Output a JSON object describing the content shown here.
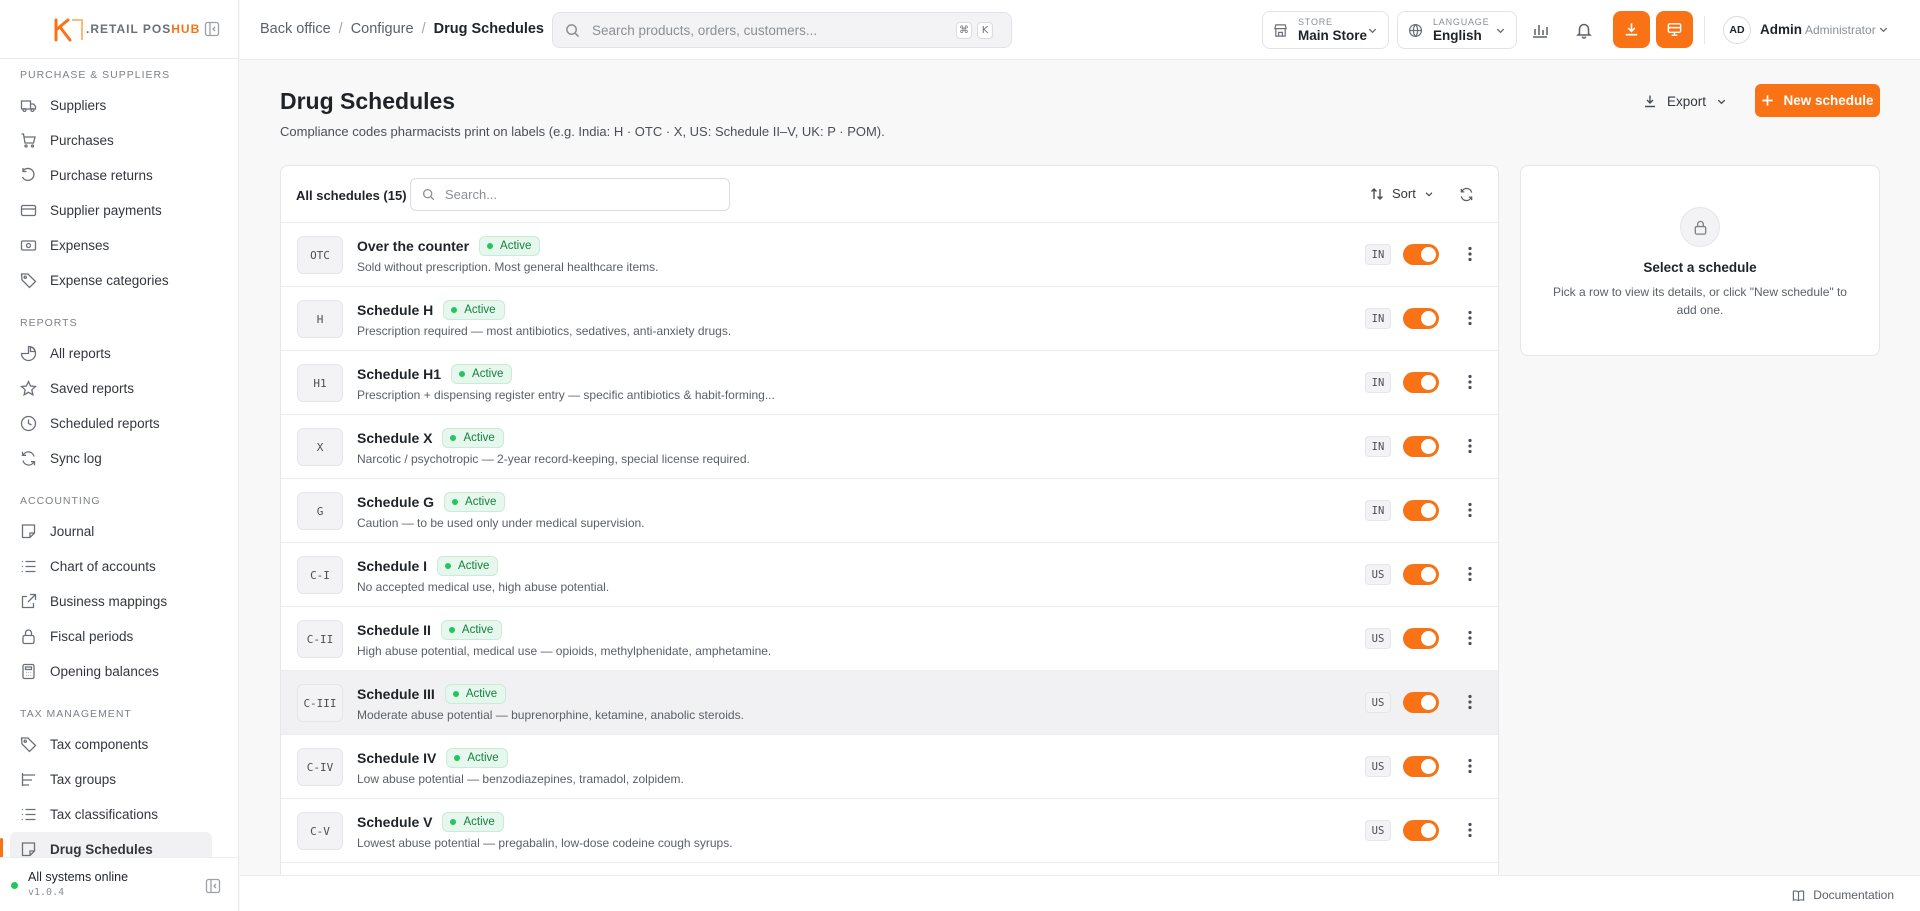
{
  "brand": {
    "name_prefix": ".RETAIL POS",
    "name_suffix": "HUB",
    "accent": "#f97316"
  },
  "sidebar": {
    "sections": [
      {
        "title": "Purchase & Suppliers",
        "items": [
          {
            "label": "Suppliers",
            "icon": "truck-icon"
          },
          {
            "label": "Purchases",
            "icon": "cart-icon"
          },
          {
            "label": "Purchase returns",
            "icon": "return-icon"
          },
          {
            "label": "Supplier payments",
            "icon": "card-icon"
          },
          {
            "label": "Expenses",
            "icon": "cash-icon"
          },
          {
            "label": "Expense categories",
            "icon": "tag-icon"
          }
        ]
      },
      {
        "title": "Reports",
        "items": [
          {
            "label": "All reports",
            "icon": "pie-icon"
          },
          {
            "label": "Saved reports",
            "icon": "star-icon"
          },
          {
            "label": "Scheduled reports",
            "icon": "clock-icon"
          },
          {
            "label": "Sync log",
            "icon": "sync-icon"
          }
        ]
      },
      {
        "title": "Accounting",
        "items": [
          {
            "label": "Journal",
            "icon": "note-icon"
          },
          {
            "label": "Chart of accounts",
            "icon": "list-icon"
          },
          {
            "label": "Business mappings",
            "icon": "external-icon"
          },
          {
            "label": "Fiscal periods",
            "icon": "lock-icon"
          },
          {
            "label": "Opening balances",
            "icon": "calculator-icon"
          }
        ]
      },
      {
        "title": "Tax Management",
        "items": [
          {
            "label": "Tax components",
            "icon": "tag-icon"
          },
          {
            "label": "Tax groups",
            "icon": "tree-icon"
          },
          {
            "label": "Tax classifications",
            "icon": "list-icon"
          },
          {
            "label": "Drug Schedules",
            "icon": "note-icon",
            "active": true
          }
        ]
      }
    ],
    "footer": {
      "status": "All systems online",
      "version": "v1.0.4"
    }
  },
  "topbar": {
    "breadcrumb": [
      "Back office",
      "Configure",
      "Drug Schedules"
    ],
    "search_placeholder": "Search products, orders, customers...",
    "shortcut": [
      "⌘",
      "K"
    ],
    "store": {
      "label": "Store",
      "value": "Main Store"
    },
    "language": {
      "label": "Language",
      "value": "English"
    },
    "user": {
      "initials": "AD",
      "name": "Admin",
      "role": "Administrator"
    }
  },
  "page": {
    "title": "Drug Schedules",
    "subtitle": "Compliance codes pharmacists print on labels (e.g. India: H · OTC · X, US: Schedule II–V, UK: P · POM).",
    "export_label": "Export",
    "new_label": "New schedule"
  },
  "list": {
    "count_label": "All schedules (15)",
    "search_placeholder": "Search...",
    "sort_label": "Sort",
    "rows": [
      {
        "code": "OTC",
        "name": "Over the counter",
        "status": "Active",
        "desc": "Sold without prescription. Most general healthcare items.",
        "region": "IN",
        "enabled": true
      },
      {
        "code": "H",
        "name": "Schedule H",
        "status": "Active",
        "desc": "Prescription required — most antibiotics, sedatives, anti-anxiety drugs.",
        "region": "IN",
        "enabled": true
      },
      {
        "code": "H1",
        "name": "Schedule H1",
        "status": "Active",
        "desc": "Prescription + dispensing register entry — specific antibiotics & habit-forming...",
        "region": "IN",
        "enabled": true
      },
      {
        "code": "X",
        "name": "Schedule X",
        "status": "Active",
        "desc": "Narcotic / psychotropic — 2-year record-keeping, special license required.",
        "region": "IN",
        "enabled": true
      },
      {
        "code": "G",
        "name": "Schedule G",
        "status": "Active",
        "desc": "Caution — to be used only under medical supervision.",
        "region": "IN",
        "enabled": true
      },
      {
        "code": "C-I",
        "name": "Schedule I",
        "status": "Active",
        "desc": "No accepted medical use, high abuse potential.",
        "region": "US",
        "enabled": true
      },
      {
        "code": "C-II",
        "name": "Schedule II",
        "status": "Active",
        "desc": "High abuse potential, medical use — opioids, methylphenidate, amphetamine.",
        "region": "US",
        "enabled": true
      },
      {
        "code": "C-III",
        "name": "Schedule III",
        "status": "Active",
        "desc": "Moderate abuse potential — buprenorphine, ketamine, anabolic steroids.",
        "region": "US",
        "enabled": true,
        "highlight": true
      },
      {
        "code": "C-IV",
        "name": "Schedule IV",
        "status": "Active",
        "desc": "Low abuse potential — benzodiazepines, tramadol, zolpidem.",
        "region": "US",
        "enabled": true
      },
      {
        "code": "C-V",
        "name": "Schedule V",
        "status": "Active",
        "desc": "Lowest abuse potential — pregabalin, low-dose codeine cough syrups.",
        "region": "US",
        "enabled": true
      }
    ]
  },
  "detail": {
    "title": "Select a schedule",
    "text": "Pick a row to view its details, or click \"New schedule\" to add one."
  },
  "bottom": {
    "doc_label": "Documentation"
  }
}
